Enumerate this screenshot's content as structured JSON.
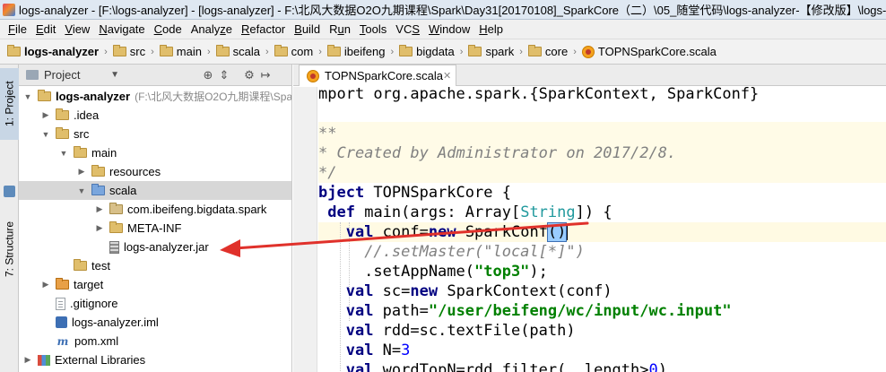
{
  "window": {
    "title": "logs-analyzer - [F:\\logs-analyzer] - [logs-analyzer] - F:\\北风大数据O2O九期课程\\Spark\\Day31[20170108]_SparkCore（二）\\05_随堂代码\\logs-analyzer-【修改版】\\logs-ana"
  },
  "menu": {
    "items": [
      {
        "label": "File",
        "u": "F",
        "rest": "ile"
      },
      {
        "label": "Edit",
        "u": "E",
        "rest": "dit"
      },
      {
        "label": "View",
        "u": "V",
        "rest": "iew"
      },
      {
        "label": "Navigate",
        "u": "N",
        "rest": "avigate"
      },
      {
        "label": "Code",
        "u": "C",
        "rest": "ode"
      },
      {
        "label": "Analyze",
        "u": "",
        "pre": "Analy",
        "u2": "z",
        "rest": "e"
      },
      {
        "label": "Refactor",
        "u": "R",
        "rest": "efactor"
      },
      {
        "label": "Build",
        "u": "B",
        "rest": "uild"
      },
      {
        "label": "Run",
        "u": "",
        "pre": "R",
        "u2": "u",
        "rest": "n"
      },
      {
        "label": "Tools",
        "u": "T",
        "rest": "ools"
      },
      {
        "label": "VCS",
        "u": "",
        "pre": "VC",
        "u2": "S",
        "rest": ""
      },
      {
        "label": "Window",
        "u": "W",
        "rest": "indow"
      },
      {
        "label": "Help",
        "u": "H",
        "rest": "elp"
      }
    ]
  },
  "breadcrumb": {
    "items": [
      "logs-analyzer",
      "src",
      "main",
      "scala",
      "com",
      "ibeifeng",
      "bigdata",
      "spark",
      "core",
      "TOPNSparkCore.scala"
    ]
  },
  "tool_strip": {
    "project_tab": "1: Project",
    "structure_tab": "7: Structure"
  },
  "project_panel": {
    "view_label": "Project",
    "icons": [
      "target-icon",
      "collapse-icon",
      "gear-icon",
      "hide-icon"
    ],
    "tree": [
      {
        "label": "logs-analyzer",
        "path": "(F:\\北风大数据O2O九期课程\\Spa",
        "depth": 0,
        "arrow": "down",
        "icon": "folder",
        "bold": true
      },
      {
        "label": ".idea",
        "depth": 1,
        "arrow": "right",
        "icon": "folder"
      },
      {
        "label": "src",
        "depth": 1,
        "arrow": "down",
        "icon": "folder"
      },
      {
        "label": "main",
        "depth": 2,
        "arrow": "down",
        "icon": "folder"
      },
      {
        "label": "resources",
        "depth": 3,
        "arrow": "right",
        "icon": "folder"
      },
      {
        "label": "scala",
        "depth": 3,
        "arrow": "down",
        "icon": "folder-blue",
        "selected": true
      },
      {
        "label": "com.ibeifeng.bigdata.spark",
        "depth": 4,
        "arrow": "right",
        "icon": "folder-pkg"
      },
      {
        "label": "META-INF",
        "depth": 4,
        "arrow": "right",
        "icon": "folder"
      },
      {
        "label": "logs-analyzer.jar",
        "depth": 4,
        "arrow": "none",
        "icon": "jar"
      },
      {
        "label": "test",
        "depth": 2,
        "arrow": "none",
        "icon": "folder"
      },
      {
        "label": "target",
        "depth": 1,
        "arrow": "right",
        "icon": "folder-orange"
      },
      {
        "label": ".gitignore",
        "depth": 1,
        "arrow": "none",
        "icon": "file"
      },
      {
        "label": "logs-analyzer.iml",
        "depth": 1,
        "arrow": "none",
        "icon": "iml"
      },
      {
        "label": "pom.xml",
        "depth": 1,
        "arrow": "none",
        "icon": "maven"
      },
      {
        "label": "External Libraries",
        "depth": 0,
        "arrow": "right",
        "icon": "lib"
      }
    ]
  },
  "editor": {
    "tab_label": "TOPNSparkCore.scala",
    "lines": [
      {
        "t": [
          [
            "plain",
            "mport org.apache.spark.{SparkContext, SparkConf}"
          ]
        ]
      },
      {
        "t": [
          [
            "plain",
            ""
          ]
        ]
      },
      {
        "t": [
          [
            "cmt",
            "**"
          ]
        ]
      },
      {
        "t": [
          [
            "cmt",
            "* Created by Administrator on 2017/2/8."
          ]
        ]
      },
      {
        "t": [
          [
            "cmt",
            "*/"
          ]
        ]
      },
      {
        "t": [
          [
            "kw",
            "bject"
          ],
          [
            "plain",
            " TOPNSparkCore {"
          ]
        ]
      },
      {
        "t": [
          [
            "plain",
            " "
          ],
          [
            "kw",
            "def"
          ],
          [
            "plain",
            " main(args: Array["
          ],
          [
            "typ",
            "String"
          ],
          [
            "plain",
            "]) {"
          ]
        ]
      },
      {
        "t": [
          [
            "plain",
            "   "
          ],
          [
            "kw",
            "val"
          ],
          [
            "plain",
            " conf="
          ],
          [
            "kw",
            "new"
          ],
          [
            "plain",
            " SparkConf"
          ],
          [
            "hl",
            "()"
          ],
          [
            "caret",
            ""
          ]
        ]
      },
      {
        "t": [
          [
            "plain",
            "     "
          ],
          [
            "cmt",
            "//.setMaster(\"local[*]\")"
          ]
        ]
      },
      {
        "t": [
          [
            "plain",
            "     .setAppName("
          ],
          [
            "str",
            "\"top3\""
          ],
          [
            "plain",
            ");"
          ]
        ]
      },
      {
        "t": [
          [
            "plain",
            "   "
          ],
          [
            "kw",
            "val"
          ],
          [
            "plain",
            " sc="
          ],
          [
            "kw",
            "new"
          ],
          [
            "plain",
            " SparkContext(conf)"
          ]
        ]
      },
      {
        "t": [
          [
            "plain",
            "   "
          ],
          [
            "kw",
            "val"
          ],
          [
            "plain",
            " path="
          ],
          [
            "str",
            "\"/user/beifeng/wc/input/wc.input\""
          ]
        ]
      },
      {
        "t": [
          [
            "plain",
            "   "
          ],
          [
            "kw",
            "val"
          ],
          [
            "plain",
            " rdd=sc.textFile(path)"
          ]
        ]
      },
      {
        "t": [
          [
            "plain",
            "   "
          ],
          [
            "kw",
            "val"
          ],
          [
            "plain",
            " N="
          ],
          [
            "num",
            "3"
          ]
        ]
      },
      {
        "t": [
          [
            "plain",
            "   "
          ],
          [
            "kw",
            "val"
          ],
          [
            "plain",
            " wordTopN=rdd.filter(_.length>"
          ],
          [
            "num",
            "0"
          ],
          [
            "plain",
            ")"
          ]
        ]
      }
    ]
  },
  "colors": {
    "accent": "#3d6fb4",
    "annotation_arrow": "#e0312b"
  }
}
